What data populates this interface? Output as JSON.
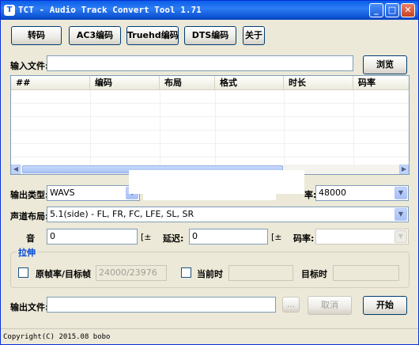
{
  "window": {
    "title": "TCT - Audio Track Convert Tool 1.71",
    "controls": {
      "minimize": "_",
      "maximize": "□",
      "close": "✕"
    }
  },
  "toolbar": {
    "transcode": "转码",
    "ac3": "AC3编码",
    "truehd": "Truehd编码",
    "dts": "DTS编码",
    "about": "关于"
  },
  "input": {
    "label": "输入文件:",
    "value": "",
    "browse": "浏览"
  },
  "tracks": {
    "columns": [
      "##",
      "编码",
      "布局",
      "格式",
      "时长",
      "码率"
    ],
    "rows": []
  },
  "output_type": {
    "label": "输出类型:",
    "value": "WAVS"
  },
  "sample_rate": {
    "label": "率:",
    "value": "48000"
  },
  "channel_layout": {
    "label": "声道布局:",
    "value": "5.1(side) - FL, FR, FC, LFE, SL, SR"
  },
  "volume": {
    "label": "音",
    "value": "0",
    "unit": "[±"
  },
  "delay": {
    "label": "延迟:",
    "value": "0",
    "unit": "[±"
  },
  "bitrate": {
    "label": "码率:",
    "value": ""
  },
  "stretch": {
    "title": "拉伸",
    "source_target_fps_label": "原帧率/目标帧",
    "source_target_fps_value": "24000/23976",
    "current_time_label": "当前时",
    "current_time_value": "",
    "target_time_label": "目标时",
    "target_time_value": ""
  },
  "output": {
    "label": "输出文件:",
    "value": "",
    "browse": "...",
    "cancel": "取消",
    "start": "开始"
  },
  "status": {
    "text": "Copyright(C) 2015.08 bobo"
  },
  "icons": {
    "app": "T",
    "dropdown": "▼",
    "scroll_left": "◀",
    "scroll_right": "▶"
  },
  "colors": {
    "title_bar": "#0A5FE8",
    "group_title": "#0046D5",
    "window_bg": "#ECE9D8"
  }
}
